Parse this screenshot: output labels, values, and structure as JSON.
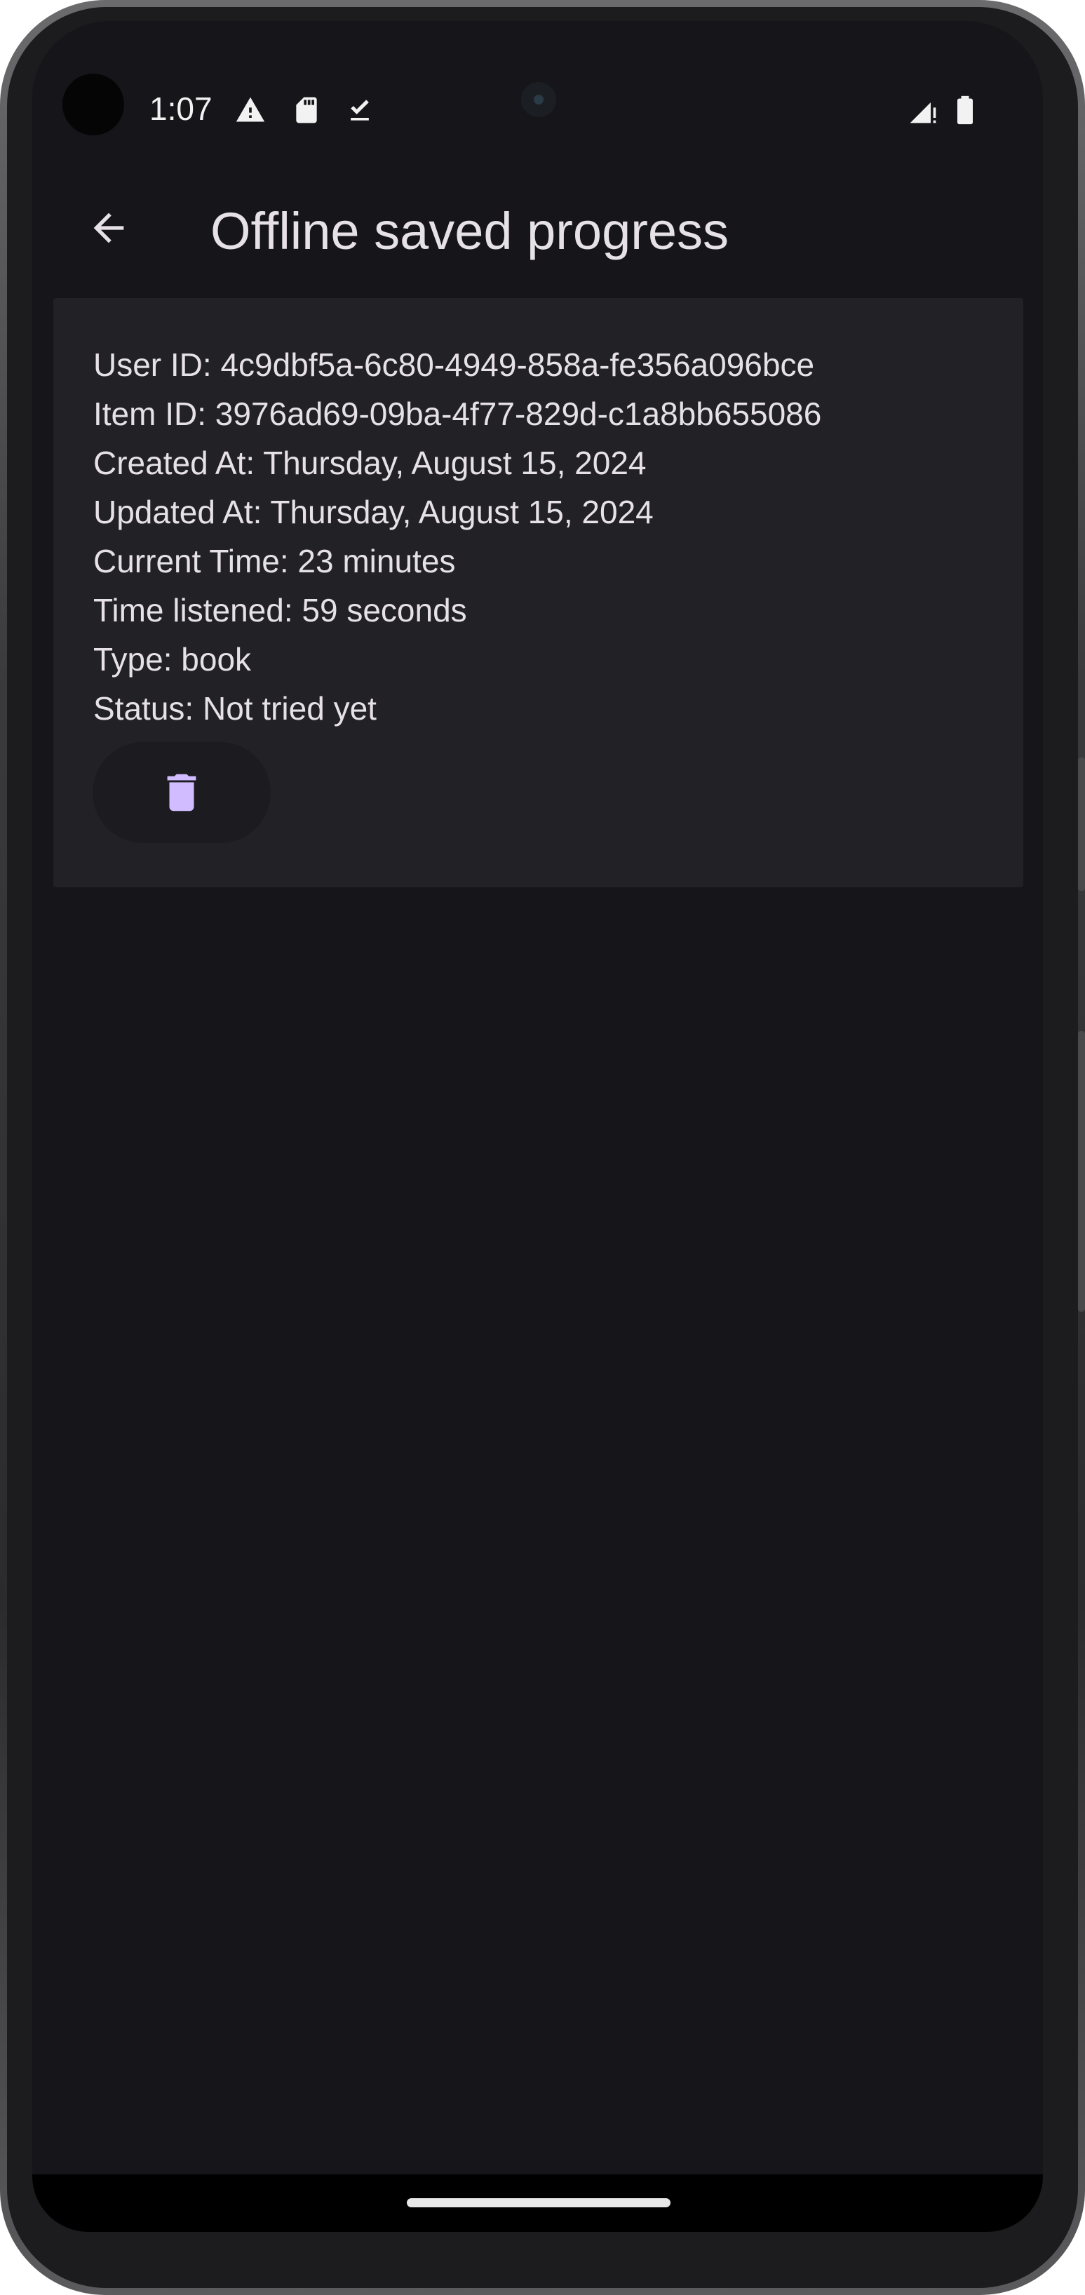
{
  "status_bar": {
    "time": "1:07",
    "icons": [
      "warning-icon",
      "sd-card-icon",
      "download-done-icon",
      "signal-icon",
      "battery-icon"
    ]
  },
  "app_bar": {
    "title": "Offline saved progress",
    "back_icon": "arrow-back-icon"
  },
  "progress_item": {
    "user_id": "User ID: 4c9dbf5a-6c80-4949-858a-fe356a096bce",
    "item_id": "Item ID: 3976ad69-09ba-4f77-829d-c1a8bb655086",
    "created_at": "Created At: Thursday, August 15, 2024",
    "updated_at": "Updated At: Thursday, August 15, 2024",
    "current_time": "Current Time: 23 minutes",
    "time_listened": "Time listened: 59 seconds",
    "type": "Type: book",
    "status": "Status: Not tried yet",
    "delete_icon": "trash-icon"
  },
  "colors": {
    "background": "#16151a",
    "card": "#222126",
    "text": "#e6e1e6",
    "accent": "#d0bcff"
  }
}
